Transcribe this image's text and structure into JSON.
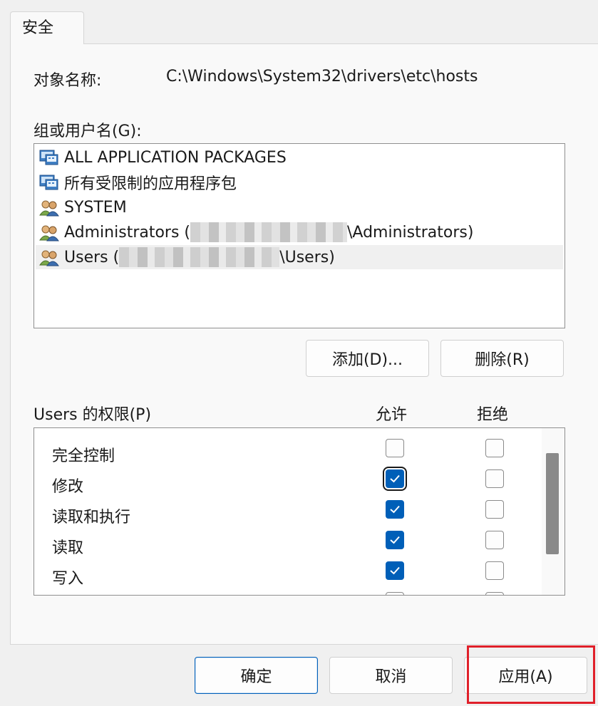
{
  "tab": {
    "label": "安全"
  },
  "object": {
    "label": "对象名称:",
    "value": "C:\\Windows\\System32\\drivers\\etc\\hosts"
  },
  "groups": {
    "label": "组或用户名(G):",
    "items": [
      {
        "name": "ALL APPLICATION PACKAGES",
        "icon": "package-group-icon",
        "suffix": ""
      },
      {
        "name": "所有受限制的应用程序包",
        "icon": "package-group-icon",
        "suffix": ""
      },
      {
        "name": "SYSTEM",
        "icon": "users-icon",
        "suffix": ""
      },
      {
        "name": "Administrators (",
        "icon": "users-icon",
        "suffix": "\\Administrators)"
      },
      {
        "name": "Users (",
        "icon": "users-icon",
        "suffix": "\\Users)"
      }
    ]
  },
  "buttons": {
    "add": "添加(D)...",
    "remove": "删除(R)"
  },
  "permissions": {
    "label": "Users 的权限(P)",
    "allow_header": "允许",
    "deny_header": "拒绝",
    "rows": [
      {
        "name": "完全控制",
        "allow": false,
        "deny": false
      },
      {
        "name": "修改",
        "allow": true,
        "deny": false
      },
      {
        "name": "读取和执行",
        "allow": true,
        "deny": false
      },
      {
        "name": "读取",
        "allow": true,
        "deny": false
      },
      {
        "name": "写入",
        "allow": true,
        "deny": false
      }
    ]
  },
  "footer": {
    "ok": "确定",
    "cancel": "取消",
    "apply": "应用(A)"
  },
  "colors": {
    "accent": "#005fb8",
    "highlight_box": "#e0202a"
  }
}
